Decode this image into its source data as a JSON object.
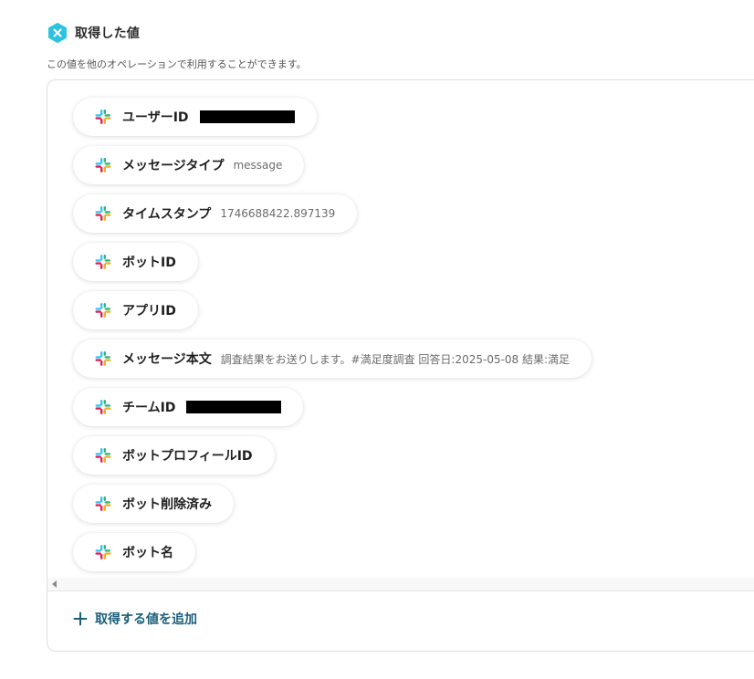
{
  "header": {
    "title": "取得した値",
    "description": "この値を他のオペレーションで利用することができます。",
    "icon": "x-hexagon-icon",
    "icon_color": "#2cc3e0"
  },
  "items": [
    {
      "label": "ユーザーID",
      "value": "",
      "redacted": true
    },
    {
      "label": "メッセージタイプ",
      "value": "message",
      "redacted": false
    },
    {
      "label": "タイムスタンプ",
      "value": "1746688422.897139",
      "redacted": false
    },
    {
      "label": "ボットID",
      "value": "",
      "redacted": false
    },
    {
      "label": "アプリID",
      "value": "",
      "redacted": false
    },
    {
      "label": "メッセージ本文",
      "value": "調査結果をお送りします。#満足度調査 回答日:2025-05-08 結果:満足",
      "redacted": false
    },
    {
      "label": "チームID",
      "value": "",
      "redacted": true
    },
    {
      "label": "ボットプロフィールID",
      "value": "",
      "redacted": false
    },
    {
      "label": "ボット削除済み",
      "value": "",
      "redacted": false
    },
    {
      "label": "ボット名",
      "value": "",
      "redacted": false
    }
  ],
  "item_icon": "slack-icon",
  "add_button": {
    "label": "取得する値を追加",
    "icon": "plus-icon",
    "color": "#1a5f7a"
  }
}
